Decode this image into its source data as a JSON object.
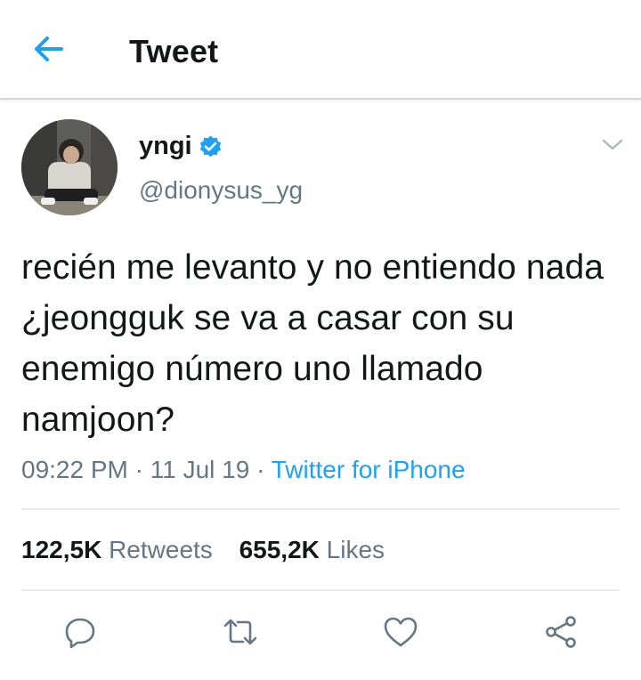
{
  "header": {
    "title": "Tweet",
    "back_icon": "arrow-left-icon"
  },
  "tweet": {
    "author": {
      "display_name": "yngi",
      "handle": "@dionysus_yg",
      "verified": true
    },
    "text": "recién me levanto y no entiendo nada ¿jeongguk se va a casar con su enemigo número uno llamado namjoon?",
    "time": "09:22 PM",
    "separator": "·",
    "date": "11 Jul 19",
    "source": "Twitter for iPhone",
    "stats": {
      "retweets_count": "122,5K",
      "retweets_label": "Retweets",
      "likes_count": "655,2K",
      "likes_label": "Likes"
    },
    "actions": [
      "reply-icon",
      "retweet-icon",
      "like-icon",
      "share-icon"
    ]
  },
  "colors": {
    "accent": "#1da1f2",
    "text_primary": "#14171a",
    "text_secondary": "#657786",
    "divider": "#e6ecf0"
  }
}
